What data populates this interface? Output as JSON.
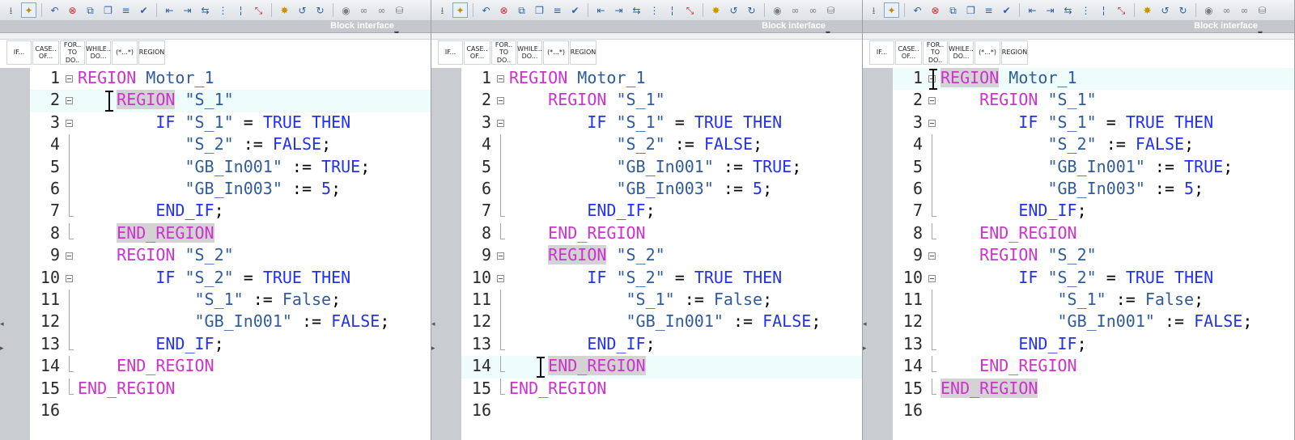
{
  "toolbar_icons": [
    "down-arrow-icon",
    "region-wizard-icon",
    "call-icon",
    "delete-call-icon",
    "copy-icon",
    "paste-icon",
    "list-icon",
    "check-icon",
    "indent-left-icon",
    "indent-right-icon",
    "outdent-icon",
    "comment-icon",
    "line-icon",
    "filter-icon",
    "bookmark-icon",
    "undo-icon",
    "redo-icon",
    "monitor-icon",
    "glasses-icon",
    "glasses2-icon",
    "db-icon"
  ],
  "block_interface_label": "Block interface",
  "templates": [
    {
      "label": "IF..."
    },
    {
      "label": "CASE..\nOF..."
    },
    {
      "label": "FOR..\nTO DO.."
    },
    {
      "label": "WHILE..\nDO..."
    },
    {
      "label": "(*...*)"
    },
    {
      "label": "REGION"
    }
  ],
  "lines": [
    {
      "num": "1",
      "indent": "",
      "tokens": [
        [
          "r",
          "REGION"
        ],
        [
          "s",
          " "
        ],
        [
          "i",
          "Motor_1"
        ]
      ]
    },
    {
      "num": "2",
      "indent": "    ",
      "tokens": [
        [
          "r",
          "REGION"
        ],
        [
          "s",
          " "
        ],
        [
          "i",
          "\"S_1\""
        ]
      ]
    },
    {
      "num": "3",
      "indent": "        ",
      "tokens": [
        [
          "k",
          "IF"
        ],
        [
          "s",
          " "
        ],
        [
          "i",
          "\"S_1\""
        ],
        [
          "s",
          " = "
        ],
        [
          "k",
          "TRUE"
        ],
        [
          "s",
          " "
        ],
        [
          "k",
          "THEN"
        ]
      ]
    },
    {
      "num": "4",
      "indent": "           ",
      "tokens": [
        [
          "i",
          "\"S_2\""
        ],
        [
          "s",
          " := "
        ],
        [
          "k",
          "FALSE"
        ],
        [
          "s",
          ";"
        ]
      ]
    },
    {
      "num": "5",
      "indent": "           ",
      "tokens": [
        [
          "i",
          "\"GB_In001\""
        ],
        [
          "s",
          " := "
        ],
        [
          "k",
          "TRUE"
        ],
        [
          "s",
          ";"
        ]
      ]
    },
    {
      "num": "6",
      "indent": "           ",
      "tokens": [
        [
          "i",
          "\"GB_In003\""
        ],
        [
          "s",
          " := "
        ],
        [
          "n",
          "5"
        ],
        [
          "s",
          ";"
        ]
      ]
    },
    {
      "num": "7",
      "indent": "        ",
      "tokens": [
        [
          "k",
          "END_IF"
        ],
        [
          "s",
          ";"
        ]
      ]
    },
    {
      "num": "8",
      "indent": "    ",
      "tokens": [
        [
          "r",
          "END_REGION"
        ]
      ]
    },
    {
      "num": "9",
      "indent": "    ",
      "tokens": [
        [
          "r",
          "REGION"
        ],
        [
          "s",
          " "
        ],
        [
          "i",
          "\"S_2\""
        ]
      ]
    },
    {
      "num": "10",
      "indent": "        ",
      "tokens": [
        [
          "k",
          "IF"
        ],
        [
          "s",
          " "
        ],
        [
          "i",
          "\"S_2\""
        ],
        [
          "s",
          " = "
        ],
        [
          "k",
          "TRUE"
        ],
        [
          "s",
          " "
        ],
        [
          "k",
          "THEN"
        ]
      ]
    },
    {
      "num": "11",
      "indent": "            ",
      "tokens": [
        [
          "i",
          "\"S_1\""
        ],
        [
          "s",
          " := "
        ],
        [
          "i",
          "False"
        ],
        [
          "s",
          ";"
        ]
      ]
    },
    {
      "num": "12",
      "indent": "            ",
      "tokens": [
        [
          "i",
          "\"GB_In001\""
        ],
        [
          "s",
          " := "
        ],
        [
          "k",
          "FALSE"
        ],
        [
          "s",
          ";"
        ]
      ]
    },
    {
      "num": "13",
      "indent": "        ",
      "tokens": [
        [
          "k",
          "END_IF"
        ],
        [
          "s",
          ";"
        ]
      ]
    },
    {
      "num": "14",
      "indent": "    ",
      "tokens": [
        [
          "r",
          "END_REGION"
        ]
      ]
    },
    {
      "num": "15",
      "indent": "",
      "tokens": [
        [
          "r",
          "END_REGION"
        ]
      ]
    },
    {
      "num": "16",
      "indent": "",
      "tokens": []
    }
  ],
  "panes": [
    {
      "highlight_line": 2,
      "selected": [
        {
          "line": 2,
          "token": 0
        },
        {
          "line": 8,
          "token": 0
        }
      ],
      "cursor_line": 2
    },
    {
      "highlight_line": 14,
      "selected": [
        {
          "line": 9,
          "token": 0
        },
        {
          "line": 14,
          "token": 0
        }
      ],
      "cursor_line": 14
    },
    {
      "highlight_line": 1,
      "selected": [
        {
          "line": 1,
          "token": 0
        },
        {
          "line": 15,
          "token": 0
        }
      ],
      "cursor_line": 1
    }
  ]
}
